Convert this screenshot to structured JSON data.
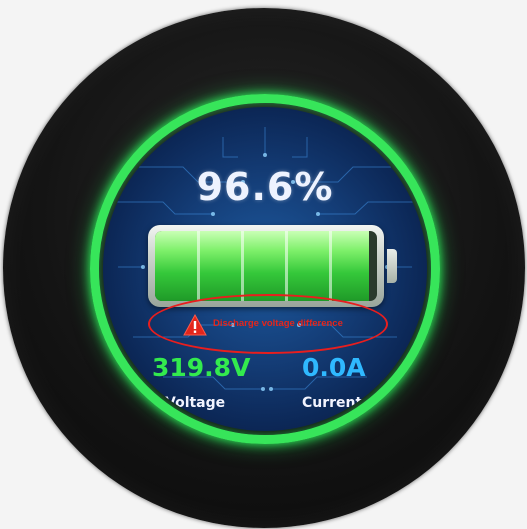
{
  "display": {
    "battery_percent_text": "96.6%",
    "battery_level": 0.966,
    "warning_text": "Discharge voltage difference",
    "voltage": {
      "value": "319.8V",
      "label": "Voltage"
    },
    "current": {
      "value": "0.0A",
      "label": "Current"
    },
    "page_indicator": {
      "count": 2,
      "active": 1
    }
  },
  "colors": {
    "ring": "#37e55a",
    "voltage": "#33ea4e",
    "current": "#2fb9ff",
    "warning": "#e3261c",
    "annotation": "#e81e1e"
  },
  "icons": {
    "warning": "warning-triangle-icon",
    "battery": "battery-icon"
  }
}
